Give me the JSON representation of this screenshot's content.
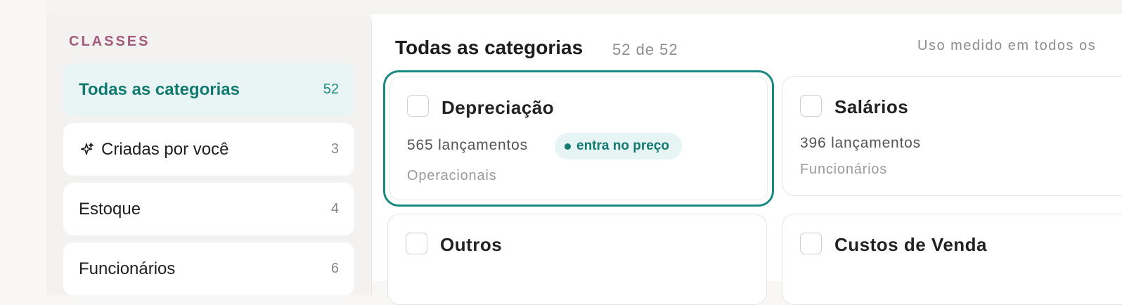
{
  "sidebar": {
    "section_title": "CLASSES",
    "items": [
      {
        "label": "Todas as categorias",
        "count": "52",
        "icon": ""
      },
      {
        "label": "Criadas por você",
        "count": "3",
        "icon": "sparkle-icon"
      },
      {
        "label": "Estoque",
        "count": "4",
        "icon": ""
      },
      {
        "label": "Funcionários",
        "count": "6",
        "icon": ""
      }
    ]
  },
  "main": {
    "title": "Todas as categorias",
    "subtitle": "52 de 52",
    "note": "Uso medido em todos os"
  },
  "cards": [
    {
      "title": "Depreciação",
      "count": "565 lançamentos",
      "badge": "entra no preço",
      "group": "Operacionais",
      "selected": true
    },
    {
      "title": "Salários",
      "count": "396 lançamentos",
      "badge": "",
      "group": "Funcionários",
      "selected": false
    },
    {
      "title": "Outros",
      "count": "",
      "badge": "",
      "group": "",
      "selected": false
    },
    {
      "title": "Custos de Venda",
      "count": "",
      "badge": "",
      "group": "",
      "selected": false
    }
  ],
  "colors": {
    "accent": "#198a83",
    "section_title": "#a35a7c"
  }
}
